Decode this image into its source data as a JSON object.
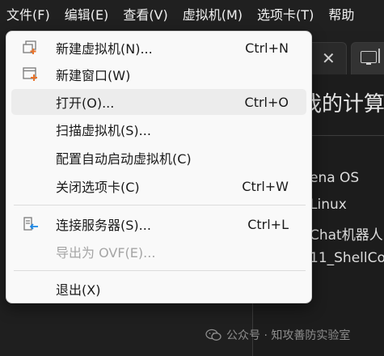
{
  "menubar": {
    "items": [
      "文件(F)",
      "编辑(E)",
      "查看(V)",
      "虚拟机(M)",
      "选项卡(T)",
      "帮助"
    ]
  },
  "background": {
    "heading": "我的计算",
    "lines": [
      "ena OS",
      "Linux",
      "Chat机器人",
      "11_ShellCo"
    ]
  },
  "file_menu": {
    "items": [
      {
        "label": "新建虚拟机(N)...",
        "shortcut": "Ctrl+N",
        "icon": "new-vm-icon"
      },
      {
        "label": "新建窗口(W)",
        "shortcut": "",
        "icon": "new-window-icon"
      },
      {
        "label": "打开(O)...",
        "shortcut": "Ctrl+O",
        "icon": ""
      },
      {
        "label": "扫描虚拟机(S)...",
        "shortcut": "",
        "icon": ""
      },
      {
        "label": "配置自动启动虚拟机(C)",
        "shortcut": "",
        "icon": ""
      },
      {
        "label": "关闭选项卡(C)",
        "shortcut": "Ctrl+W",
        "icon": ""
      },
      {
        "label": "连接服务器(S)...",
        "shortcut": "Ctrl+L",
        "icon": "connect-server-icon"
      },
      {
        "label": "导出为 OVF(E)...",
        "shortcut": "",
        "icon": "",
        "disabled": true
      },
      {
        "label": "退出(X)",
        "shortcut": "",
        "icon": ""
      }
    ]
  },
  "watermark": {
    "text": "公众号 · 知攻善防实验室"
  },
  "colors": {
    "menu_bg": "#f9f9f9",
    "app_bg": "#1f1f1f",
    "accent_orange": "#e8742c",
    "accent_blue": "#1e88e5"
  }
}
